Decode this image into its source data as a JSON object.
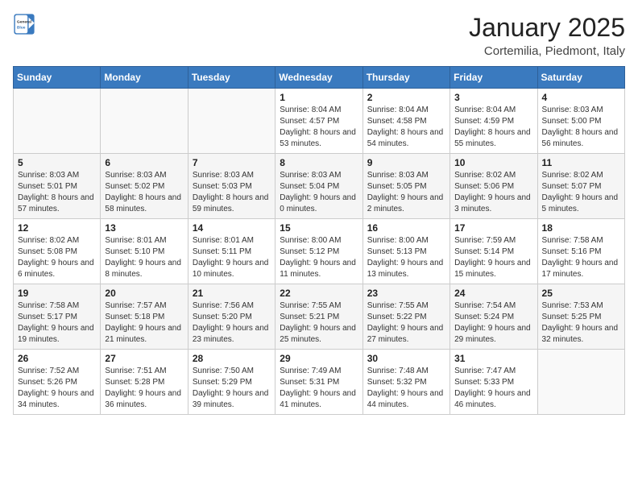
{
  "header": {
    "logo_general": "General",
    "logo_blue": "Blue",
    "title": "January 2025",
    "subtitle": "Cortemilia, Piedmont, Italy"
  },
  "weekdays": [
    "Sunday",
    "Monday",
    "Tuesday",
    "Wednesday",
    "Thursday",
    "Friday",
    "Saturday"
  ],
  "weeks": [
    [
      {
        "day": "",
        "detail": ""
      },
      {
        "day": "",
        "detail": ""
      },
      {
        "day": "",
        "detail": ""
      },
      {
        "day": "1",
        "detail": "Sunrise: 8:04 AM\nSunset: 4:57 PM\nDaylight: 8 hours and 53 minutes."
      },
      {
        "day": "2",
        "detail": "Sunrise: 8:04 AM\nSunset: 4:58 PM\nDaylight: 8 hours and 54 minutes."
      },
      {
        "day": "3",
        "detail": "Sunrise: 8:04 AM\nSunset: 4:59 PM\nDaylight: 8 hours and 55 minutes."
      },
      {
        "day": "4",
        "detail": "Sunrise: 8:03 AM\nSunset: 5:00 PM\nDaylight: 8 hours and 56 minutes."
      }
    ],
    [
      {
        "day": "5",
        "detail": "Sunrise: 8:03 AM\nSunset: 5:01 PM\nDaylight: 8 hours and 57 minutes."
      },
      {
        "day": "6",
        "detail": "Sunrise: 8:03 AM\nSunset: 5:02 PM\nDaylight: 8 hours and 58 minutes."
      },
      {
        "day": "7",
        "detail": "Sunrise: 8:03 AM\nSunset: 5:03 PM\nDaylight: 8 hours and 59 minutes."
      },
      {
        "day": "8",
        "detail": "Sunrise: 8:03 AM\nSunset: 5:04 PM\nDaylight: 9 hours and 0 minutes."
      },
      {
        "day": "9",
        "detail": "Sunrise: 8:03 AM\nSunset: 5:05 PM\nDaylight: 9 hours and 2 minutes."
      },
      {
        "day": "10",
        "detail": "Sunrise: 8:02 AM\nSunset: 5:06 PM\nDaylight: 9 hours and 3 minutes."
      },
      {
        "day": "11",
        "detail": "Sunrise: 8:02 AM\nSunset: 5:07 PM\nDaylight: 9 hours and 5 minutes."
      }
    ],
    [
      {
        "day": "12",
        "detail": "Sunrise: 8:02 AM\nSunset: 5:08 PM\nDaylight: 9 hours and 6 minutes."
      },
      {
        "day": "13",
        "detail": "Sunrise: 8:01 AM\nSunset: 5:10 PM\nDaylight: 9 hours and 8 minutes."
      },
      {
        "day": "14",
        "detail": "Sunrise: 8:01 AM\nSunset: 5:11 PM\nDaylight: 9 hours and 10 minutes."
      },
      {
        "day": "15",
        "detail": "Sunrise: 8:00 AM\nSunset: 5:12 PM\nDaylight: 9 hours and 11 minutes."
      },
      {
        "day": "16",
        "detail": "Sunrise: 8:00 AM\nSunset: 5:13 PM\nDaylight: 9 hours and 13 minutes."
      },
      {
        "day": "17",
        "detail": "Sunrise: 7:59 AM\nSunset: 5:14 PM\nDaylight: 9 hours and 15 minutes."
      },
      {
        "day": "18",
        "detail": "Sunrise: 7:58 AM\nSunset: 5:16 PM\nDaylight: 9 hours and 17 minutes."
      }
    ],
    [
      {
        "day": "19",
        "detail": "Sunrise: 7:58 AM\nSunset: 5:17 PM\nDaylight: 9 hours and 19 minutes."
      },
      {
        "day": "20",
        "detail": "Sunrise: 7:57 AM\nSunset: 5:18 PM\nDaylight: 9 hours and 21 minutes."
      },
      {
        "day": "21",
        "detail": "Sunrise: 7:56 AM\nSunset: 5:20 PM\nDaylight: 9 hours and 23 minutes."
      },
      {
        "day": "22",
        "detail": "Sunrise: 7:55 AM\nSunset: 5:21 PM\nDaylight: 9 hours and 25 minutes."
      },
      {
        "day": "23",
        "detail": "Sunrise: 7:55 AM\nSunset: 5:22 PM\nDaylight: 9 hours and 27 minutes."
      },
      {
        "day": "24",
        "detail": "Sunrise: 7:54 AM\nSunset: 5:24 PM\nDaylight: 9 hours and 29 minutes."
      },
      {
        "day": "25",
        "detail": "Sunrise: 7:53 AM\nSunset: 5:25 PM\nDaylight: 9 hours and 32 minutes."
      }
    ],
    [
      {
        "day": "26",
        "detail": "Sunrise: 7:52 AM\nSunset: 5:26 PM\nDaylight: 9 hours and 34 minutes."
      },
      {
        "day": "27",
        "detail": "Sunrise: 7:51 AM\nSunset: 5:28 PM\nDaylight: 9 hours and 36 minutes."
      },
      {
        "day": "28",
        "detail": "Sunrise: 7:50 AM\nSunset: 5:29 PM\nDaylight: 9 hours and 39 minutes."
      },
      {
        "day": "29",
        "detail": "Sunrise: 7:49 AM\nSunset: 5:31 PM\nDaylight: 9 hours and 41 minutes."
      },
      {
        "day": "30",
        "detail": "Sunrise: 7:48 AM\nSunset: 5:32 PM\nDaylight: 9 hours and 44 minutes."
      },
      {
        "day": "31",
        "detail": "Sunrise: 7:47 AM\nSunset: 5:33 PM\nDaylight: 9 hours and 46 minutes."
      },
      {
        "day": "",
        "detail": ""
      }
    ]
  ]
}
